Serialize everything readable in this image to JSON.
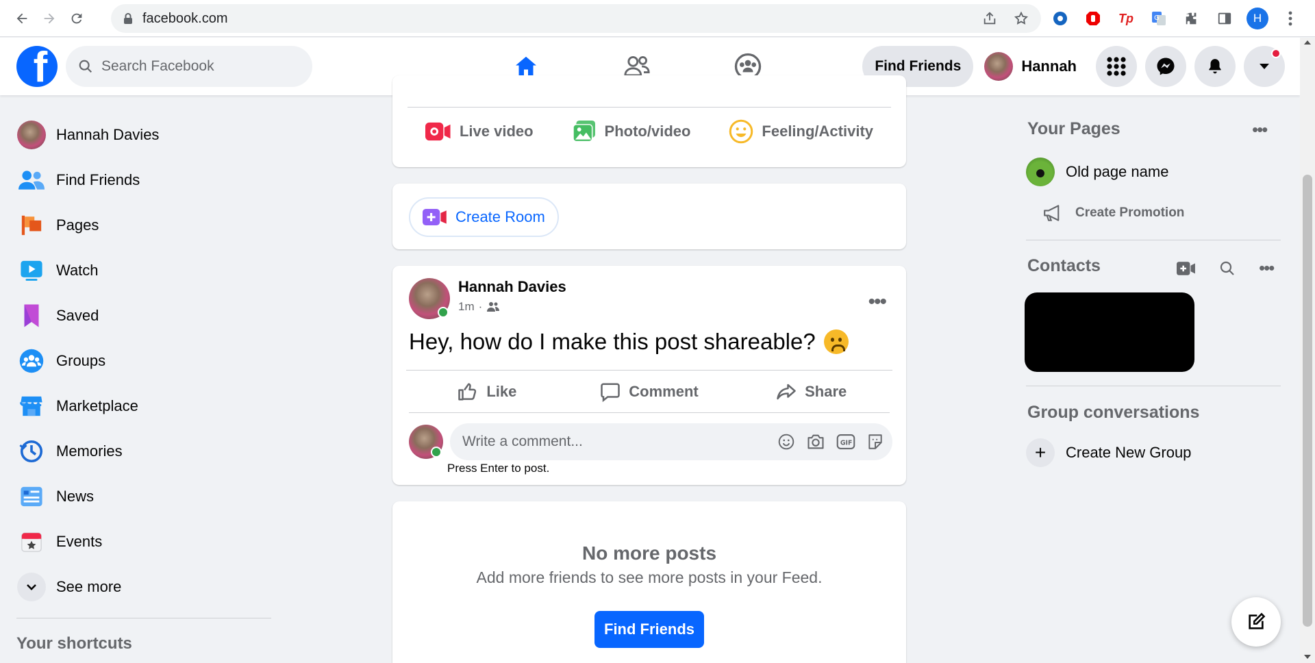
{
  "browser": {
    "url": "facebook.com",
    "profile_initial": "H"
  },
  "header": {
    "search_placeholder": "Search Facebook",
    "find_friends": "Find Friends",
    "user_name": "Hannah"
  },
  "left_nav": {
    "items": [
      {
        "label": "Hannah Davies",
        "icon": "avatar"
      },
      {
        "label": "Find Friends",
        "icon": "friends-icon"
      },
      {
        "label": "Pages",
        "icon": "flag-icon"
      },
      {
        "label": "Watch",
        "icon": "watch-icon"
      },
      {
        "label": "Saved",
        "icon": "bookmark-icon"
      },
      {
        "label": "Groups",
        "icon": "groups-icon"
      },
      {
        "label": "Marketplace",
        "icon": "shop-icon"
      },
      {
        "label": "Memories",
        "icon": "clock-icon"
      },
      {
        "label": "News",
        "icon": "news-icon"
      },
      {
        "label": "Events",
        "icon": "calendar-icon"
      },
      {
        "label": "See more",
        "icon": "chevron-down-icon"
      }
    ],
    "shortcuts_title": "Your shortcuts"
  },
  "composer": {
    "live_video": "Live video",
    "photo_video": "Photo/video",
    "feeling": "Feeling/Activity"
  },
  "room": {
    "label": "Create Room"
  },
  "post": {
    "author": "Hannah Davies",
    "time": "1m",
    "text": "Hey, how do I make this post shareable?",
    "like": "Like",
    "comment": "Comment",
    "share": "Share",
    "comment_placeholder": "Write a comment...",
    "press_enter": "Press Enter to post."
  },
  "feed_end": {
    "title": "No more posts",
    "subtitle": "Add more friends to see more posts in your Feed.",
    "button": "Find Friends"
  },
  "right": {
    "your_pages": "Your Pages",
    "page_name": "Old page name",
    "create_promotion": "Create Promotion",
    "contacts": "Contacts",
    "group_conversations": "Group conversations",
    "create_new_group": "Create New Group"
  },
  "colors": {
    "brand": "#0866ff",
    "background": "#f0f2f5",
    "muted_text": "#65676b"
  }
}
